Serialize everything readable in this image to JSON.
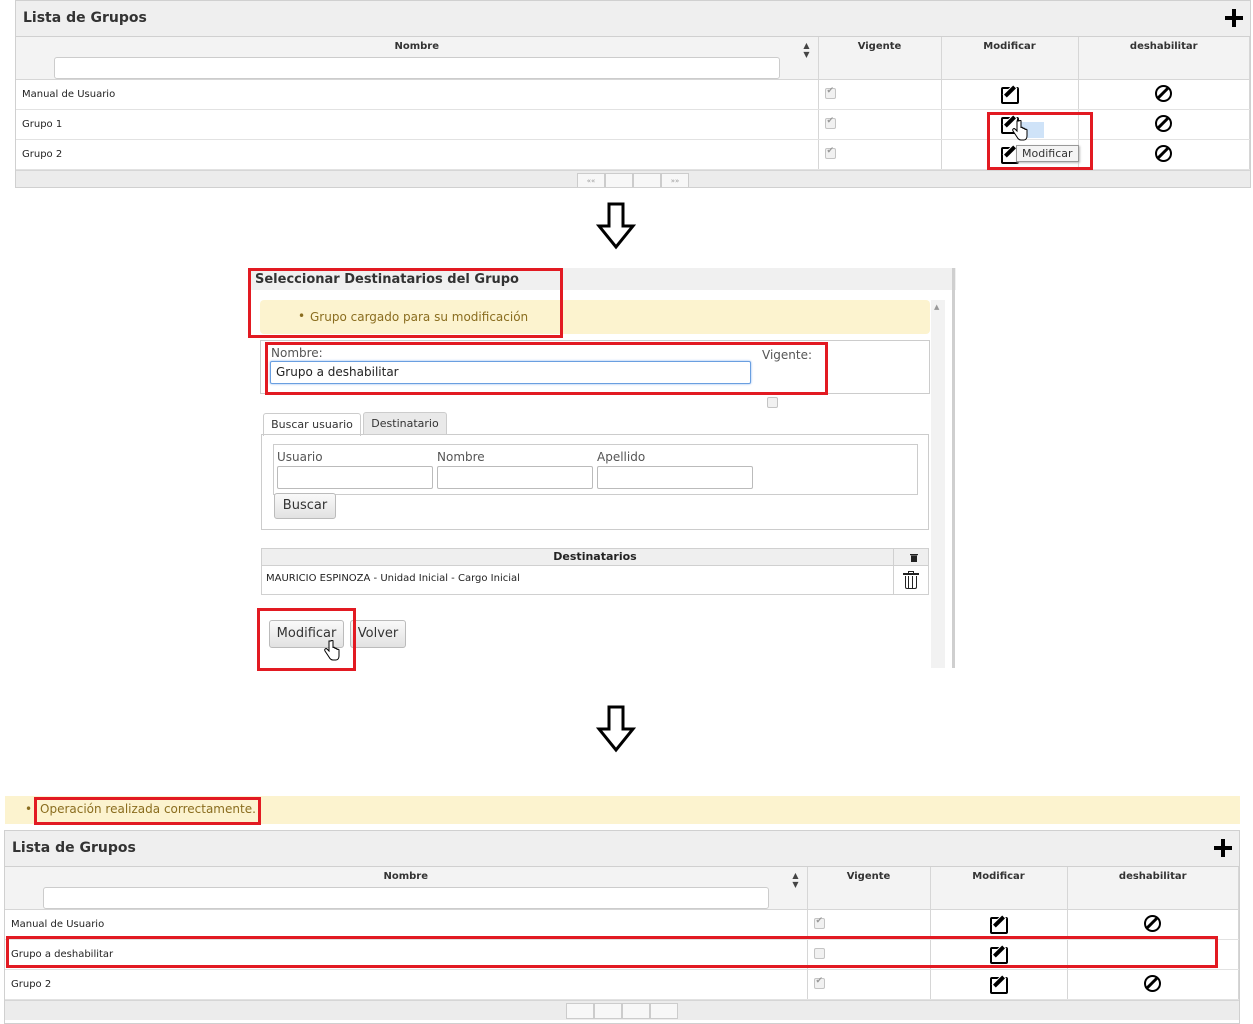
{
  "list_top": {
    "title": "Lista de Grupos",
    "columns": {
      "nombre": "Nombre",
      "vigente": "Vigente",
      "modificar": "Modificar",
      "deshabilitar": "deshabilitar"
    },
    "rows": [
      {
        "name": "Manual de Usuario",
        "vigente": true
      },
      {
        "name": "Grupo 1",
        "vigente": true
      },
      {
        "name": "Grupo 2",
        "vigente": true
      }
    ],
    "tooltip": "Modificar"
  },
  "dialog": {
    "title": "Seleccionar Destinatarios del Grupo",
    "message": "Grupo cargado para su modificación",
    "nombre_label": "Nombre:",
    "nombre_value": "Grupo a deshabilitar",
    "vigente_label": "Vigente:",
    "vigente_checked": false,
    "tabs": [
      "Buscar usuario",
      "Destinatario"
    ],
    "search_fields": {
      "usuario": "Usuario",
      "nombre": "Nombre",
      "apellido": "Apellido"
    },
    "buscar_button": "Buscar",
    "destinatarios_header": "Destinatarios",
    "destinatarios": [
      "MAURICIO ESPINOZA - Unidad Inicial - Cargo Inicial"
    ],
    "modificar_button": "Modificar",
    "volver_button": "Volver"
  },
  "result": {
    "message": "Operación realizada correctamente."
  },
  "list_bottom": {
    "title": "Lista de Grupos",
    "columns": {
      "nombre": "Nombre",
      "vigente": "Vigente",
      "modificar": "Modificar",
      "deshabilitar": "deshabilitar"
    },
    "rows": [
      {
        "name": "Manual de Usuario",
        "vigente": true,
        "can_disable": true
      },
      {
        "name": "Grupo a deshabilitar",
        "vigente": false,
        "can_disable": false
      },
      {
        "name": "Grupo 2",
        "vigente": true,
        "can_disable": true
      }
    ]
  },
  "colors": {
    "highlight": "#e21a22",
    "message_bg": "#fcf3cf",
    "message_text": "#8a6d1f"
  }
}
